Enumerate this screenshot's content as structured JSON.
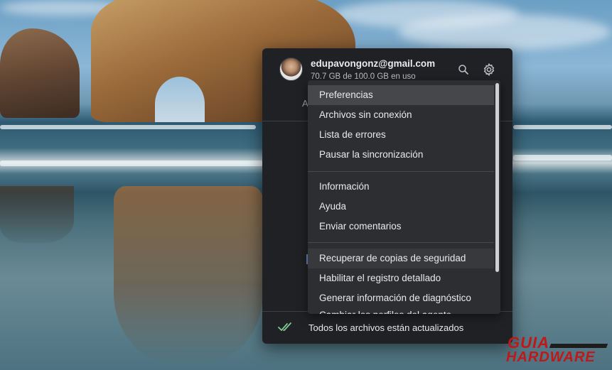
{
  "account": {
    "email": "edupavongonz@gmail.com",
    "usage": "70.7 GB de 100.0 GB en uso"
  },
  "header": {
    "search_icon": "search-icon",
    "settings_icon": "gear-icon",
    "tab_fragment": "A"
  },
  "menu": {
    "items": [
      {
        "label": "Preferencias"
      },
      {
        "label": "Archivos sin conexión"
      },
      {
        "label": "Lista de errores"
      },
      {
        "label": "Pausar la sincronización"
      },
      {
        "label": "Información"
      },
      {
        "label": "Ayuda"
      },
      {
        "label": "Enviar comentarios"
      },
      {
        "label": "Recuperar de copias de seguridad"
      },
      {
        "label": "Habilitar el registro detallado"
      },
      {
        "label": "Generar información de diagnóstico"
      },
      {
        "label": "Cambiar los perfiles del agente"
      }
    ]
  },
  "footer": {
    "status": "Todos los archivos están actualizados",
    "status_icon": "double-check-icon"
  },
  "watermark": {
    "line1": "GUIA",
    "line2": "HARDWARE"
  },
  "colors": {
    "panel_bg": "#202124",
    "menu_bg": "#2d2e31",
    "menu_highlight": "#45474a",
    "check_green": "#81c995",
    "watermark_red": "#c01818"
  }
}
